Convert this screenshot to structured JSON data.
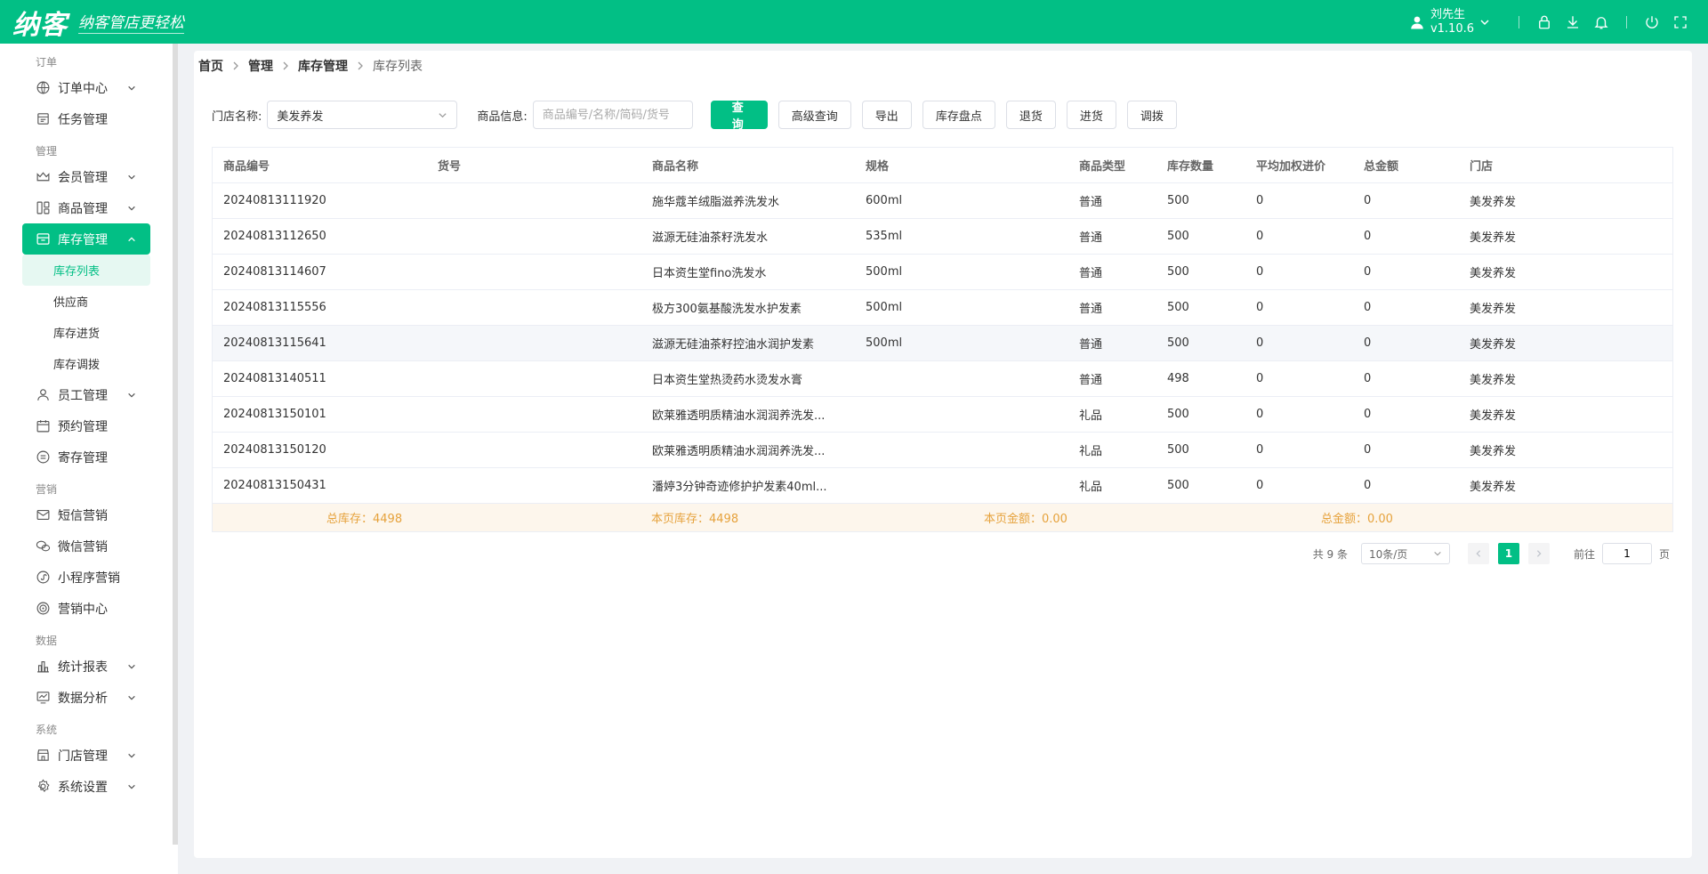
{
  "header": {
    "logo": "纳客",
    "slogan": "纳客管店更轻松",
    "user_name": "刘先生",
    "version": "v1.10.6"
  },
  "sidebar": {
    "groups": [
      {
        "title": "订单",
        "items": [
          {
            "label": "订单中心",
            "icon": "globe-icon",
            "arrow": true
          },
          {
            "label": "任务管理",
            "icon": "task-icon",
            "arrow": false
          }
        ]
      },
      {
        "title": "管理",
        "items": [
          {
            "label": "会员管理",
            "icon": "crown-icon",
            "arrow": true
          },
          {
            "label": "商品管理",
            "icon": "product-icon",
            "arrow": true
          },
          {
            "label": "库存管理",
            "icon": "store-icon",
            "arrow": true,
            "active": true,
            "children": [
              "库存列表",
              "供应商",
              "库存进货",
              "库存调拨"
            ]
          },
          {
            "label": "员工管理",
            "icon": "user-icon",
            "arrow": true
          },
          {
            "label": "预约管理",
            "icon": "calendar-icon",
            "arrow": false
          },
          {
            "label": "寄存管理",
            "icon": "deposit-icon",
            "arrow": false
          }
        ]
      },
      {
        "title": "营销",
        "items": [
          {
            "label": "短信营销",
            "icon": "mail-icon",
            "arrow": false
          },
          {
            "label": "微信营销",
            "icon": "wechat-icon",
            "arrow": false
          },
          {
            "label": "小程序营销",
            "icon": "miniprogram-icon",
            "arrow": false
          },
          {
            "label": "营销中心",
            "icon": "target-icon",
            "arrow": false
          }
        ]
      },
      {
        "title": "数据",
        "items": [
          {
            "label": "统计报表",
            "icon": "chart-icon",
            "arrow": true
          },
          {
            "label": "数据分析",
            "icon": "analysis-icon",
            "arrow": true
          }
        ]
      },
      {
        "title": "系统",
        "items": [
          {
            "label": "门店管理",
            "icon": "shop-icon",
            "arrow": true
          },
          {
            "label": "系统设置",
            "icon": "gear-icon",
            "arrow": true
          }
        ]
      }
    ],
    "active_child": "库存列表"
  },
  "breadcrumb": [
    "首页",
    "管理",
    "库存管理",
    "库存列表"
  ],
  "filter": {
    "store_label": "门店名称:",
    "store_value": "美发养发",
    "product_label": "商品信息:",
    "product_placeholder": "商品编号/名称/简码/货号",
    "buttons": [
      "查 询",
      "高级查询",
      "导出",
      "库存盘点",
      "退货",
      "进货",
      "调拨"
    ]
  },
  "table": {
    "columns": [
      "商品编号",
      "货号",
      "商品名称",
      "规格",
      "商品类型",
      "库存数量",
      "平均加权进价",
      "总金额",
      "门店"
    ],
    "rows": [
      [
        "20240813111920",
        "",
        "施华蔻羊绒脂滋养洗发水",
        "600ml",
        "普通",
        "500",
        "0",
        "0",
        "美发养发"
      ],
      [
        "20240813112650",
        "",
        "滋源无硅油茶籽洗发水",
        "535ml",
        "普通",
        "500",
        "0",
        "0",
        "美发养发"
      ],
      [
        "20240813114607",
        "",
        "日本资生堂fino洗发水",
        "500ml",
        "普通",
        "500",
        "0",
        "0",
        "美发养发"
      ],
      [
        "20240813115556",
        "",
        "极方300氨基酸洗发水护发素",
        "500ml",
        "普通",
        "500",
        "0",
        "0",
        "美发养发"
      ],
      [
        "20240813115641",
        "",
        "滋源无硅油茶籽控油水润护发素",
        "500ml",
        "普通",
        "500",
        "0",
        "0",
        "美发养发"
      ],
      [
        "20240813140511",
        "",
        "日本资生堂热烫药水烫发水膏",
        "",
        "普通",
        "498",
        "0",
        "0",
        "美发养发"
      ],
      [
        "20240813150101",
        "",
        "欧莱雅透明质精油水润润养洗发...",
        "",
        "礼品",
        "500",
        "0",
        "0",
        "美发养发"
      ],
      [
        "20240813150120",
        "",
        "欧莱雅透明质精油水润润养洗发...",
        "",
        "礼品",
        "500",
        "0",
        "0",
        "美发养发"
      ],
      [
        "20240813150431",
        "",
        "潘婷3分钟奇迹修护护发素40ml...",
        "",
        "礼品",
        "500",
        "0",
        "0",
        "美发养发"
      ]
    ],
    "highlight_row": 4,
    "summary": {
      "total_stock": "总库存：4498",
      "page_stock": "本页库存：4498",
      "page_amount": "本页金额：0.00",
      "total_amount": "总金额：0.00"
    }
  },
  "pagination": {
    "total": "共 9 条",
    "page_size": "10条/页",
    "current_page": "1",
    "goto_label": "前往",
    "goto_value": "1",
    "page_suffix": "页"
  },
  "colors": {
    "brand": "#02bf85",
    "summary_text": "#e6a23c"
  }
}
